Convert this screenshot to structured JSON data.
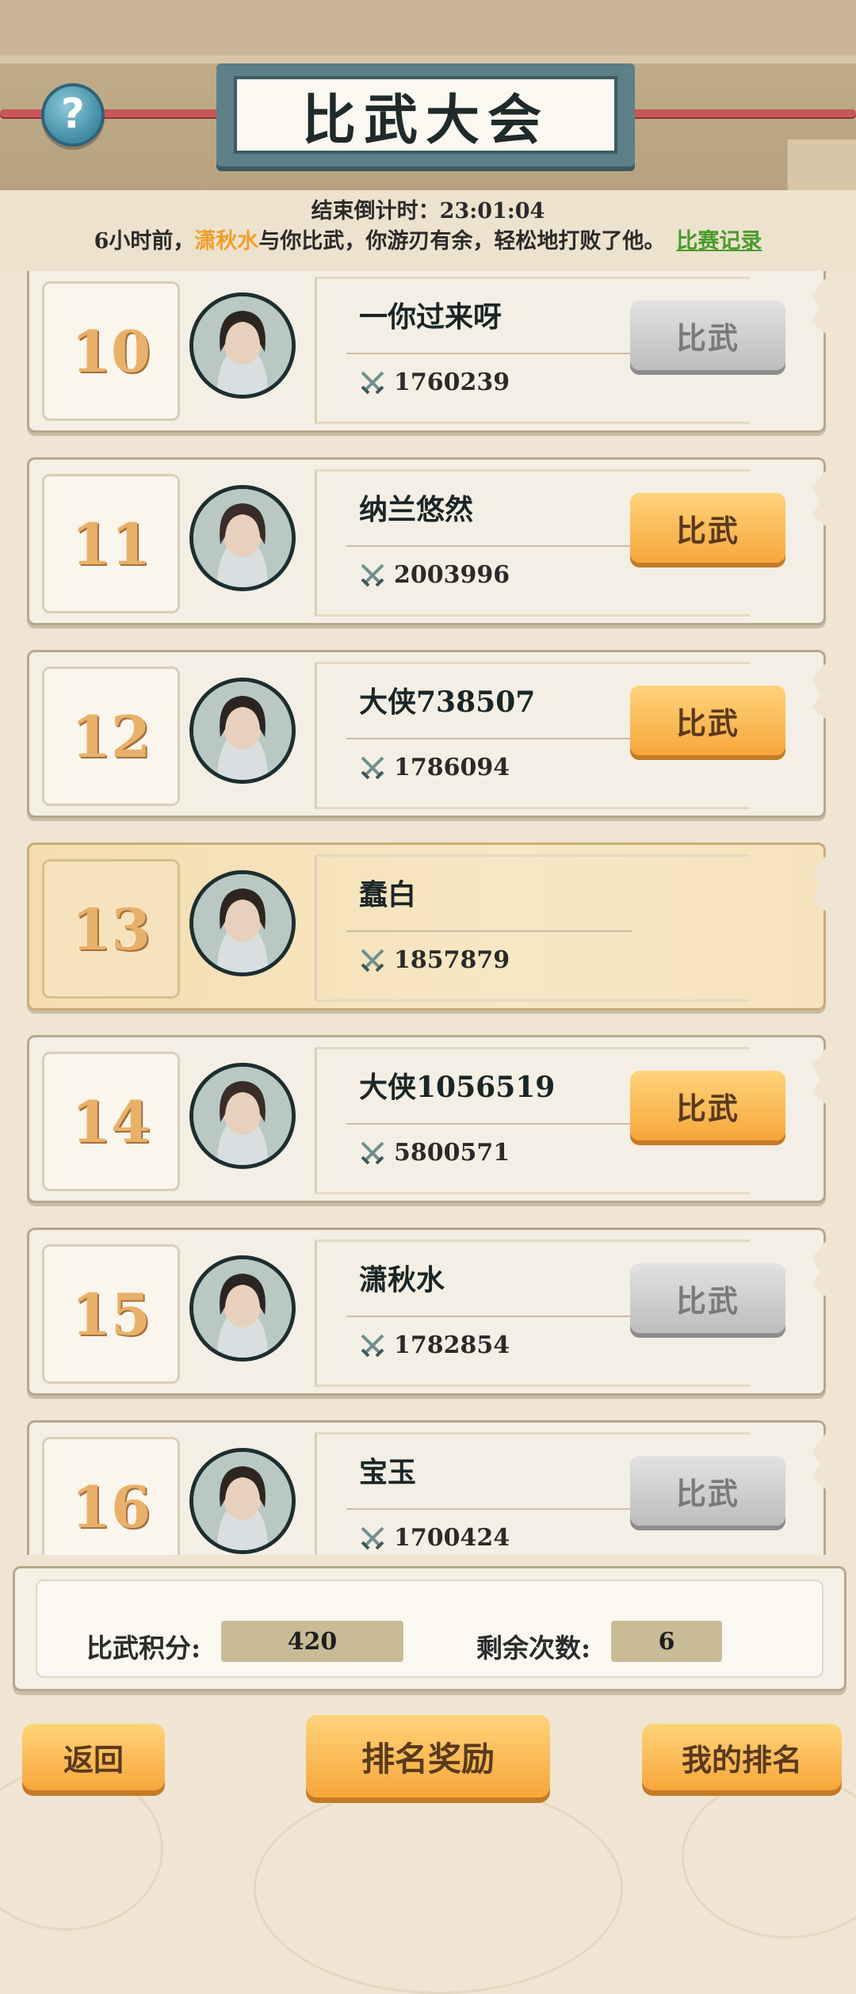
{
  "header": {
    "title": "比武大会",
    "help_symbol": "?",
    "countdown_label": "结束倒计时：",
    "countdown_value": "23:01:04"
  },
  "news": {
    "prefix": "6小时前，",
    "highlight_name": "潇秋水",
    "suffix": "与你比武，你游刃有余，轻松地打败了他。",
    "record_link": "比赛记录"
  },
  "entries": [
    {
      "rank": "10",
      "name": "一你过来呀",
      "power": "1760239",
      "button": "比武",
      "button_enabled": false,
      "is_me": false
    },
    {
      "rank": "11",
      "name": "纳兰悠然",
      "power": "2003996",
      "button": "比武",
      "button_enabled": true,
      "is_me": false
    },
    {
      "rank": "12",
      "name": "大侠738507",
      "power": "1786094",
      "button": "比武",
      "button_enabled": true,
      "is_me": false
    },
    {
      "rank": "13",
      "name": "蠢白",
      "power": "1857879",
      "button": "",
      "button_enabled": false,
      "is_me": true
    },
    {
      "rank": "14",
      "name": "大侠1056519",
      "power": "5800571",
      "button": "比武",
      "button_enabled": true,
      "is_me": false
    },
    {
      "rank": "15",
      "name": "潇秋水",
      "power": "1782854",
      "button": "比武",
      "button_enabled": false,
      "is_me": false
    },
    {
      "rank": "16",
      "name": "宝玉",
      "power": "1700424",
      "button": "比武",
      "button_enabled": false,
      "is_me": false
    }
  ],
  "score": {
    "points_label": "比武积分:",
    "points_value": "420",
    "remaining_label": "剩余次数:",
    "remaining_value": "6"
  },
  "footer": {
    "back_label": "返回",
    "rewards_label": "排名奖励",
    "my_rank_label": "我的排名"
  },
  "colors": {
    "accent_orange": "#f7a73b",
    "disabled_gray": "#bdbdbd",
    "highlight_name": "#f0a02a",
    "link_green": "#4a9b2d",
    "rope_red": "#c8565a"
  }
}
